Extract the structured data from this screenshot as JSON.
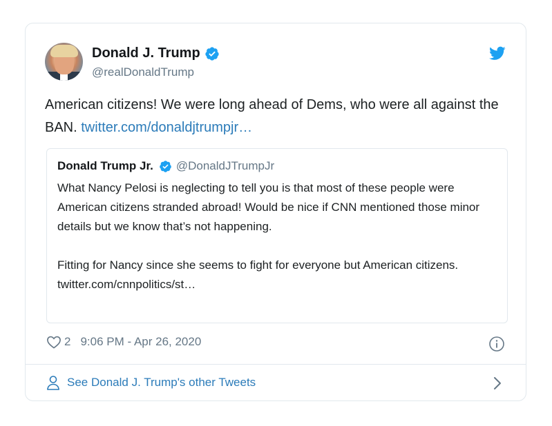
{
  "author": {
    "name": "Donald J. Trump",
    "handle": "@realDonaldTrump"
  },
  "tweet": {
    "text_part1": "American citizens! We were long ahead of Dems, who were all against the BAN. ",
    "link": "twitter.com/donaldjtrumpjr…"
  },
  "quoted": {
    "name": "Donald Trump Jr.",
    "handle": "@DonaldJTrumpJr",
    "paragraph1": "What Nancy Pelosi is neglecting to tell you is that most of these people were American citizens stranded abroad! Would be nice if CNN mentioned those minor details but we know that’s not happening.",
    "paragraph2": "Fitting for Nancy since she seems to fight for everyone but American citizens. twitter.com/cnnpolitics/st…"
  },
  "meta": {
    "likes": "2",
    "timestamp": "9:06 PM - Apr 26, 2020"
  },
  "footer": {
    "link_text": "See Donald J. Trump's other Tweets"
  },
  "icons": {
    "verified": "verified-badge-icon",
    "bird": "twitter-bird-icon",
    "heart": "heart-icon",
    "info": "info-icon",
    "person": "person-icon",
    "chevron": "chevron-right-icon"
  },
  "colors": {
    "link": "#2b7bb9",
    "verified": "#1da1f2",
    "secondary_text": "#657786",
    "border": "#e1e8ed"
  }
}
